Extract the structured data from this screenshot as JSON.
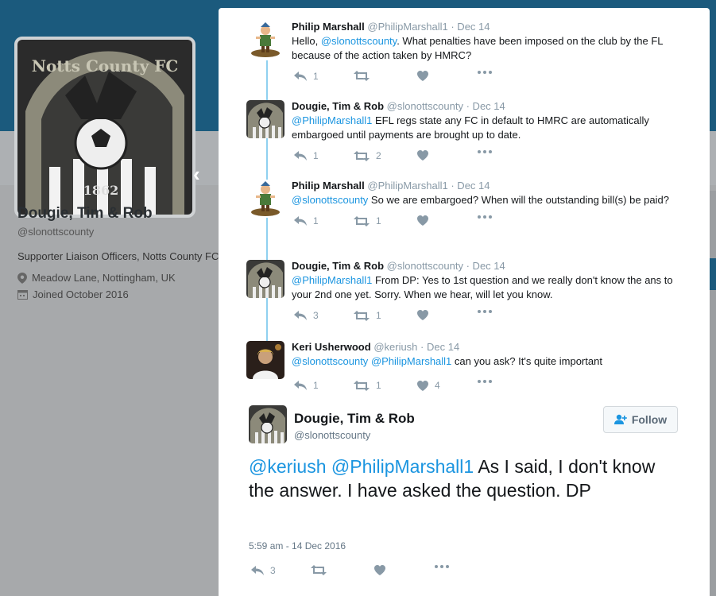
{
  "profile": {
    "logo_text_top": "Notts County FC",
    "logo_year": "1862",
    "name": "Dougie, Tim & Rob",
    "handle": "@slonottscounty",
    "bio": "Supporter Liaison Officers, Notts County FC",
    "location": "Meadow Lane, Nottingham, UK",
    "joined": "Joined October 2016"
  },
  "replies": [
    {
      "name": "Philip Marshall",
      "handle": "@PhilipMarshall1",
      "date": "· Dec 14",
      "text_parts": [
        {
          "t": "Hello, ",
          "m": false
        },
        {
          "t": "@slonottscounty",
          "m": true
        },
        {
          "t": ". What penalties have been imposed on the club by the FL because of the action taken by HMRC?",
          "m": false
        }
      ],
      "reply_count": "1",
      "retweet_count": "",
      "like_count": "",
      "avatar": "figure"
    },
    {
      "name": "Dougie, Tim & Rob",
      "handle": "@slonottscounty",
      "date": "· Dec 14",
      "text_parts": [
        {
          "t": "@PhilipMarshall1",
          "m": true
        },
        {
          "t": " EFL regs state any FC in default to HMRC are automatically embargoed until payments are brought up to date.",
          "m": false
        }
      ],
      "reply_count": "1",
      "retweet_count": "2",
      "like_count": "",
      "avatar": "crest"
    },
    {
      "name": "Philip Marshall",
      "handle": "@PhilipMarshall1",
      "date": "· Dec 14",
      "text_parts": [
        {
          "t": "@slonottscounty",
          "m": true
        },
        {
          "t": " So we are embargoed? When will the outstanding bill(s) be paid?",
          "m": false
        }
      ],
      "reply_count": "1",
      "retweet_count": "1",
      "like_count": "",
      "avatar": "figure"
    },
    {
      "name": "Dougie, Tim & Rob",
      "handle": "@slonottscounty",
      "date": "· Dec 14",
      "text_parts": [
        {
          "t": "@PhilipMarshall1",
          "m": true
        },
        {
          "t": " From DP: Yes to 1st question and we really don't know the ans to your 2nd one yet. Sorry. When we hear, will let you know.",
          "m": false
        }
      ],
      "reply_count": "3",
      "retweet_count": "1",
      "like_count": "",
      "avatar": "crest"
    },
    {
      "name": "Keri Usherwood",
      "handle": "@keriush",
      "date": "· Dec 14",
      "text_parts": [
        {
          "t": "@slonottscounty",
          "m": true
        },
        {
          "t": " ",
          "m": false
        },
        {
          "t": "@PhilipMarshall1",
          "m": true
        },
        {
          "t": " can you ask? It's quite important",
          "m": false
        }
      ],
      "reply_count": "1",
      "retweet_count": "1",
      "like_count": "4",
      "avatar": "photo"
    }
  ],
  "main_tweet": {
    "name": "Dougie, Tim & Rob",
    "handle": "@slonottscounty",
    "follow_label": "Follow",
    "text_parts": [
      {
        "t": "@keriush",
        "m": true
      },
      {
        "t": " ",
        "m": false
      },
      {
        "t": "@PhilipMarshall1",
        "m": true
      },
      {
        "t": " As I said, I don't know the answer.  I have asked the question. DP",
        "m": false
      }
    ],
    "timestamp": "5:59 am - 14 Dec 2016",
    "reply_count": "3",
    "retweet_count": "",
    "like_count": ""
  },
  "colors": {
    "mention": "#1b95e0",
    "header_bg": "#1b5a7d",
    "thread_line": "#8fd0f0",
    "action_grey": "#8899a6"
  }
}
